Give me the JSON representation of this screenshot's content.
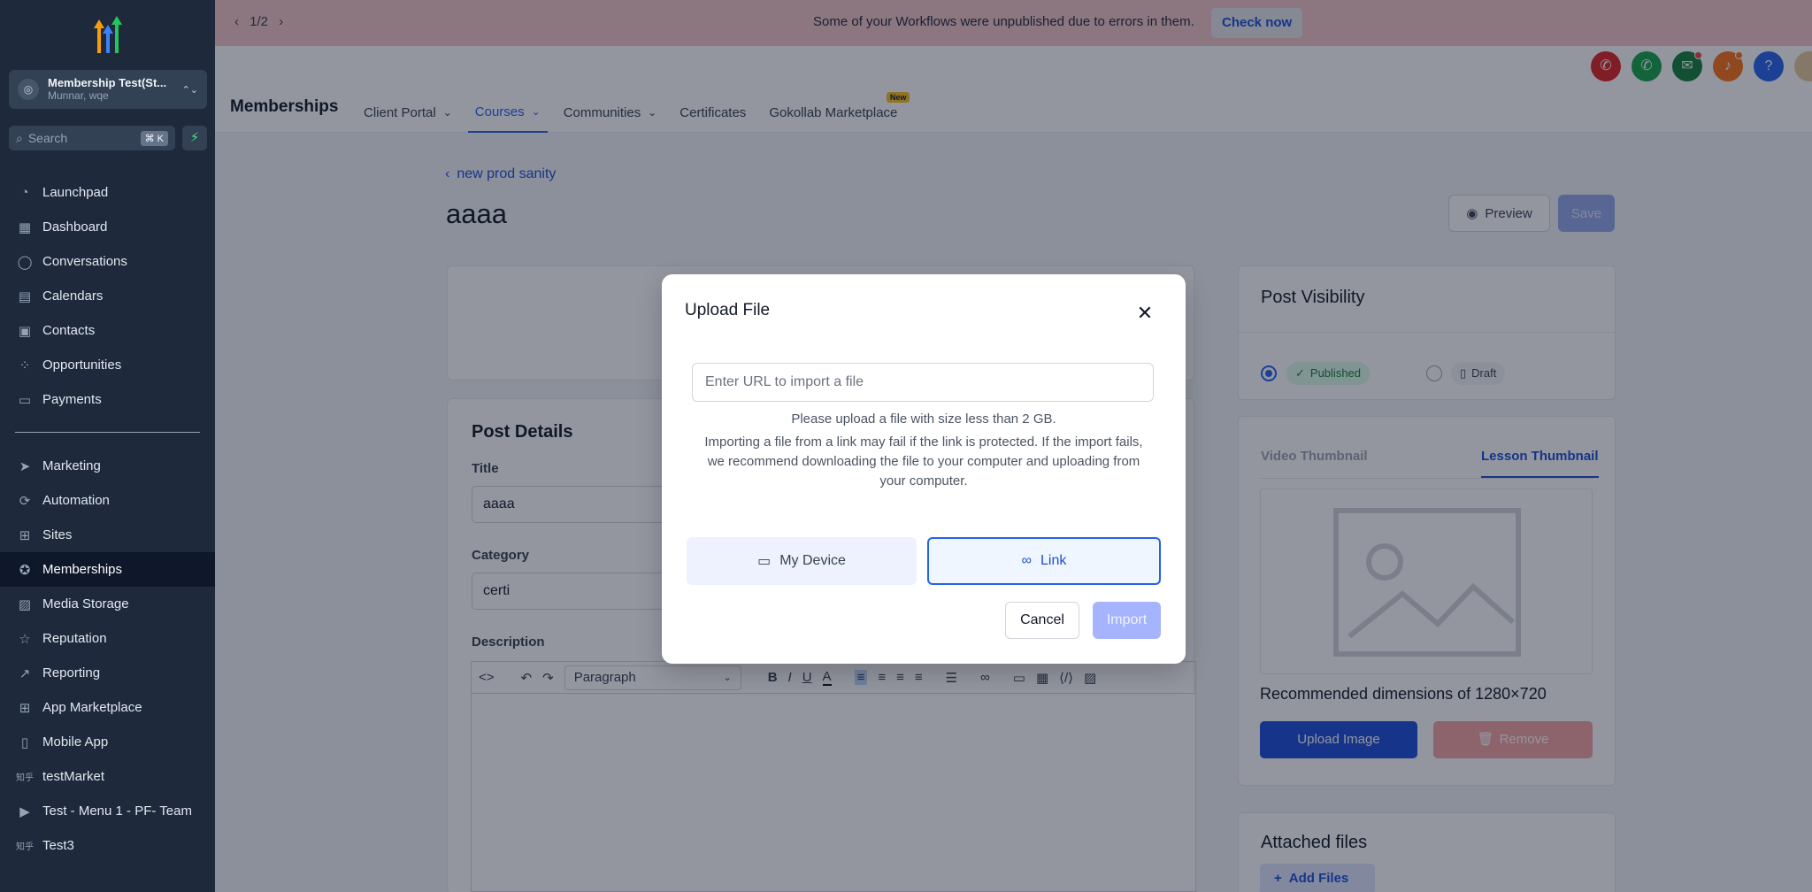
{
  "banner": {
    "pager": "1/2",
    "message": "Some of your Workflows were unpublished due to errors in them.",
    "action": "Check now"
  },
  "account": {
    "name": "Membership Test(St...",
    "location": "Munnar, wqe"
  },
  "search": {
    "placeholder": "Search",
    "shortcut": "⌘ K"
  },
  "sidebar": {
    "items": [
      {
        "label": "Launchpad",
        "icon": "launchpad-icon"
      },
      {
        "label": "Dashboard",
        "icon": "dashboard-icon"
      },
      {
        "label": "Conversations",
        "icon": "chat-icon"
      },
      {
        "label": "Calendars",
        "icon": "calendar-icon"
      },
      {
        "label": "Contacts",
        "icon": "contacts-icon"
      },
      {
        "label": "Opportunities",
        "icon": "opportunities-icon"
      },
      {
        "label": "Payments",
        "icon": "payments-icon"
      }
    ],
    "items2": [
      {
        "label": "Marketing",
        "icon": "send-icon"
      },
      {
        "label": "Automation",
        "icon": "automation-icon"
      },
      {
        "label": "Sites",
        "icon": "sites-icon"
      },
      {
        "label": "Memberships",
        "icon": "award-icon",
        "active": true
      },
      {
        "label": "Media Storage",
        "icon": "image-icon"
      },
      {
        "label": "Reputation",
        "icon": "star-icon"
      },
      {
        "label": "Reporting",
        "icon": "trend-icon"
      },
      {
        "label": "App Marketplace",
        "icon": "grid-icon"
      },
      {
        "label": "Mobile App",
        "icon": "phone-icon"
      },
      {
        "label": "testMarket",
        "icon": "zhihu-icon"
      },
      {
        "label": "Test - Menu 1 - PF- Team",
        "icon": "youtube-icon"
      },
      {
        "label": "Test3",
        "icon": "zhihu-icon"
      }
    ]
  },
  "header": {
    "title": "Memberships",
    "tabs": [
      {
        "label": "Client Portal",
        "caret": true
      },
      {
        "label": "Courses",
        "caret": true,
        "active": true
      },
      {
        "label": "Communities",
        "caret": true
      },
      {
        "label": "Certificates"
      },
      {
        "label": "Gokollab Marketplace",
        "badge": "New"
      }
    ]
  },
  "main": {
    "back_label": "new prod sanity",
    "post_title": "aaaa",
    "preview_label": "Preview",
    "save_label": "Save",
    "details": {
      "title": "Post Details",
      "title_label": "Title",
      "title_value": "aaaa",
      "category_label": "Category",
      "category_value": "certi",
      "description_label": "Description",
      "paragraph_label": "Paragraph"
    },
    "visibility": {
      "title": "Post Visibility",
      "published": "Published",
      "draft": "Draft"
    },
    "thumbnail": {
      "tab_video": "Video Thumbnail",
      "tab_lesson": "Lesson Thumbnail",
      "recommend": "Recommended dimensions of 1280×720",
      "upload": "Upload Image",
      "remove": "Remove"
    },
    "files": {
      "title": "Attached files",
      "add": "Add Files"
    }
  },
  "modal": {
    "title": "Upload File",
    "url_placeholder": "Enter URL to import a file",
    "hint_size": "Please upload a file with size less than 2 GB.",
    "hint_link": "Importing a file from a link may fail if the link is protected. If the import fails, we recommend downloading the file to your computer and uploading from your computer.",
    "device_label": "My Device",
    "link_label": "Link",
    "cancel_label": "Cancel",
    "import_label": "Import"
  },
  "colors": {
    "accent": "#2563eb",
    "sidebar": "#1e293b",
    "banner": "#f3c6c6"
  }
}
